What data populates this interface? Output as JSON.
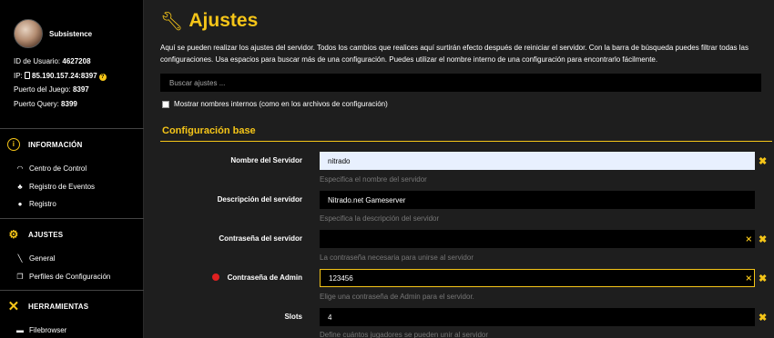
{
  "sidebar": {
    "server_name": "Subsistence",
    "user_id_label": "ID de Usuario:",
    "user_id": "4627208",
    "ip_label": "IP:",
    "ip": "85.190.157.24:8397",
    "game_port_label": "Puerto del Juego:",
    "game_port": "8397",
    "query_port_label": "Puerto Query:",
    "query_port": "8399",
    "sections": [
      {
        "title": "INFORMACIÓN",
        "icon": "info-circle-icon",
        "items": [
          {
            "label": "Centro de Control",
            "icon": "gauge-icon"
          },
          {
            "label": "Registro de Eventos",
            "icon": "bell-icon"
          },
          {
            "label": "Registro",
            "icon": "eye-icon"
          }
        ]
      },
      {
        "title": "AJUSTES",
        "icon": "gears-icon",
        "items": [
          {
            "label": "General",
            "icon": "wrench-icon"
          },
          {
            "label": "Perfiles de Configuración",
            "icon": "copy-icon"
          }
        ]
      },
      {
        "title": "HERRAMIENTAS",
        "icon": "tools-icon",
        "items": [
          {
            "label": "Filebrowser",
            "icon": "folder-icon"
          }
        ]
      }
    ]
  },
  "main": {
    "title": "Ajustes",
    "description": "Aquí se pueden realizar los ajustes del servidor. Todos los cambios que realices aquí surtirán efecto después de reiniciar el servidor. Con la barra de búsqueda puedes filtrar todas las configuraciones. Usa espacios para buscar más de una configuración. Puedes utilizar el nombre interno de una configuración para encontrarlo fácilmente.",
    "search_placeholder": "Buscar ajustes ...",
    "show_internal_label": "Mostrar nombres internos (como en los archivos de configuración)",
    "section_title": "Configuración base",
    "fields": [
      {
        "label": "Nombre del Servidor",
        "value": "nitrado",
        "hint": "Especifica el nombre del servidor",
        "required": false,
        "password": false
      },
      {
        "label": "Descripción del servidor",
        "value": "Nitrado.net Gameserver",
        "hint": "Especifica la descripción del servidor",
        "required": false,
        "password": false
      },
      {
        "label": "Contraseña del servidor",
        "value": "",
        "hint": "La contraseña necesaria para unirse al servidor",
        "required": false,
        "password": true
      },
      {
        "label": "Contraseña de Admin",
        "value": "123456",
        "hint": "Elige una contraseña de Admin para el servidor.",
        "required": true,
        "password": true
      },
      {
        "label": "Slots",
        "value": "4",
        "hint": "Define cuántos jugadores se pueden unir al servidor",
        "required": false,
        "password": false
      }
    ]
  },
  "colors": {
    "accent": "#f5c518",
    "required": "#e02020"
  }
}
